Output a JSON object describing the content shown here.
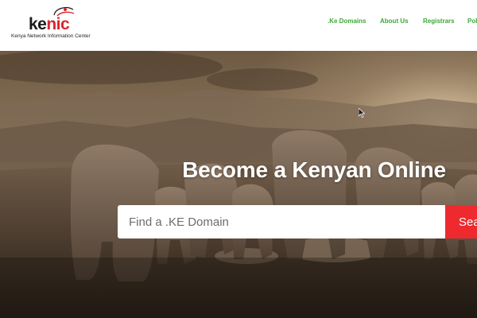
{
  "brand": {
    "logo_text_black": "ke",
    "logo_text_red": "nic",
    "tagline": "Kenya Network Information Center"
  },
  "nav": {
    "items": [
      ".Ke Domains",
      "About Us",
      "Registrars",
      "Pol"
    ]
  },
  "hero": {
    "title": "Become a Kenyan Online",
    "search": {
      "placeholder": "Find a .KE Domain",
      "value": "",
      "button_label": "Sea"
    }
  },
  "colors": {
    "nav_link": "#3aa935",
    "accent_red": "#ee2a2f",
    "logo_red": "#d9262e"
  },
  "icons": [
    "logo-arc-icon",
    "mouse-cursor-icon"
  ]
}
